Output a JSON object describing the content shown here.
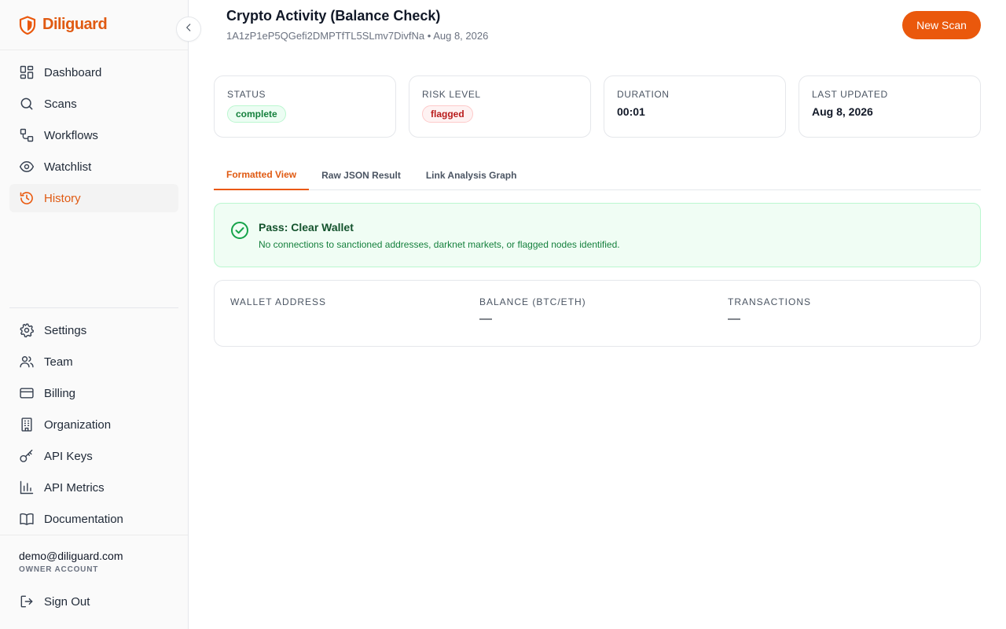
{
  "brand": {
    "name": "Diliguard",
    "accent": "#ea580c"
  },
  "sidebar": {
    "collapse_icon": "chevron-left-icon",
    "primary": [
      {
        "label": "Dashboard",
        "icon": "dashboard-icon"
      },
      {
        "label": "Scans",
        "icon": "search-icon"
      },
      {
        "label": "Workflows",
        "icon": "workflow-icon"
      },
      {
        "label": "Watchlist",
        "icon": "eye-icon"
      },
      {
        "label": "History",
        "icon": "history-icon",
        "active": true
      }
    ],
    "secondary": [
      {
        "label": "Settings",
        "icon": "gear-icon"
      },
      {
        "label": "Team",
        "icon": "users-icon"
      },
      {
        "label": "Billing",
        "icon": "credit-card-icon"
      },
      {
        "label": "Organization",
        "icon": "building-icon"
      },
      {
        "label": "API Keys",
        "icon": "key-icon"
      },
      {
        "label": "API Metrics",
        "icon": "bar-chart-icon"
      },
      {
        "label": "Documentation",
        "icon": "book-icon"
      }
    ],
    "user": {
      "email": "demo@diliguard.com",
      "role": "OWNER ACCOUNT"
    },
    "signout": {
      "label": "Sign Out",
      "icon": "log-out-icon"
    }
  },
  "header": {
    "title": "Crypto Activity (Balance Check)",
    "subtitle": "1A1zP1eP5QGefi2DMPTfTL5SLmv7DivfNa • Aug 8, 2026",
    "new_scan_label": "New Scan"
  },
  "summary_cards": {
    "status": {
      "label": "STATUS",
      "value": "complete",
      "color": "#15803d"
    },
    "risk": {
      "label": "RISK LEVEL",
      "value": "flagged",
      "color": "#b91c1c"
    },
    "duration": {
      "label": "DURATION",
      "value": "00:01"
    },
    "updated": {
      "label": "LAST UPDATED",
      "value": "Aug 8, 2026"
    }
  },
  "tabs": [
    {
      "label": "Formatted View",
      "active": true
    },
    {
      "label": "Raw JSON Result"
    },
    {
      "label": "Link Analysis Graph"
    }
  ],
  "alert": {
    "icon": "check-circle-icon",
    "title": "Pass: Clear Wallet",
    "description": "No connections to sanctioned addresses, darknet markets, or flagged nodes identified."
  },
  "details": {
    "wallet": {
      "label": "WALLET ADDRESS",
      "value": ""
    },
    "balance": {
      "label": "BALANCE (BTC/ETH)",
      "value": "—"
    },
    "transactions": {
      "label": "TRANSACTIONS",
      "value": "—"
    }
  }
}
